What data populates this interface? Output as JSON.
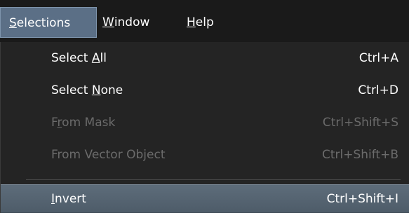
{
  "menubar": {
    "items": [
      {
        "pre": "",
        "ul": "S",
        "post": "elections"
      },
      {
        "pre": "",
        "ul": "W",
        "post": "indow"
      },
      {
        "pre": "",
        "ul": "H",
        "post": "elp"
      }
    ]
  },
  "menu": {
    "items": [
      {
        "pre": "Select ",
        "ul": "A",
        "post": "ll",
        "shortcut": "Ctrl+A",
        "state": "enabled"
      },
      {
        "pre": "Select ",
        "ul": "N",
        "post": "one",
        "shortcut": "Ctrl+D",
        "state": "enabled"
      },
      {
        "pre": "F",
        "ul": "r",
        "post": "om Mask",
        "shortcut": "Ctrl+Shift+S",
        "state": "disabled"
      },
      {
        "pre": "From Vector Ob",
        "ul": "j",
        "post": "ect",
        "shortcut": "Ctrl+Shift+B",
        "state": "disabled"
      },
      {
        "pre": "",
        "ul": "I",
        "post": "nvert",
        "shortcut": "Ctrl+Shift+I",
        "state": "highlighted"
      }
    ]
  }
}
